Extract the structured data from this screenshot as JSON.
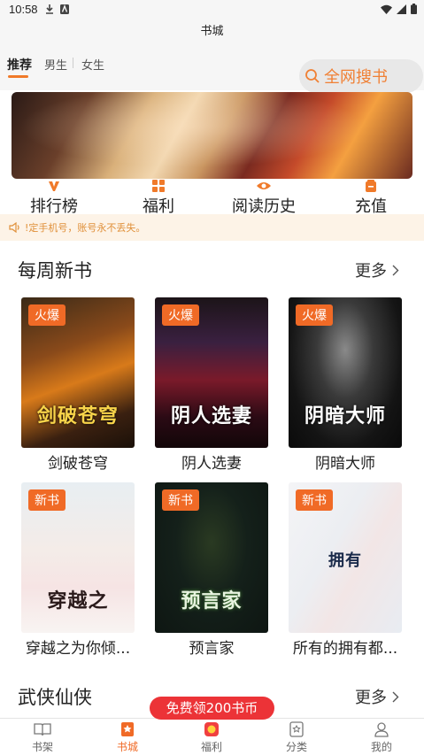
{
  "status_bar": {
    "time": "10:58"
  },
  "header": {
    "title": "书城"
  },
  "tabs": [
    {
      "label": "推荐"
    },
    {
      "label": "男生"
    },
    {
      "label": "女生"
    }
  ],
  "search": {
    "label": "全网搜书"
  },
  "quick_nav": [
    {
      "label": "排行榜",
      "icon": "ranking-icon"
    },
    {
      "label": "福利",
      "icon": "grid-icon"
    },
    {
      "label": "阅读历史",
      "icon": "eye-icon"
    },
    {
      "label": "充值",
      "icon": "wallet-icon"
    }
  ],
  "notice": {
    "text": "!定手机号，账号永不丢失。"
  },
  "section_weekly": {
    "title": "每周新书",
    "more": "更多",
    "books": [
      {
        "name": "剑破苍穹",
        "badge": "火爆",
        "cover_text": "剑破苍穹"
      },
      {
        "name": "阴人选妻",
        "badge": "火爆",
        "cover_text": "阴人选妻"
      },
      {
        "name": "阴暗大师",
        "badge": "火爆",
        "cover_text": "阴暗大师"
      },
      {
        "name": "穿越之为你倾...",
        "badge": "新书",
        "cover_text": "穿越之"
      },
      {
        "name": "预言家",
        "badge": "新书",
        "cover_text": "预言家"
      },
      {
        "name": "所有的拥有都...",
        "badge": "新书",
        "cover_text": "拥有"
      }
    ]
  },
  "section_wuxia": {
    "title": "武侠仙侠",
    "more": "更多"
  },
  "promo": {
    "text": "免费领200书币"
  },
  "bottom_nav": [
    {
      "label": "书架",
      "icon": "bookshelf-icon"
    },
    {
      "label": "书城",
      "icon": "bookstore-icon"
    },
    {
      "label": "福利",
      "icon": "gift-icon"
    },
    {
      "label": "分类",
      "icon": "category-icon"
    },
    {
      "label": "我的",
      "icon": "profile-icon"
    }
  ],
  "colors": {
    "accent": "#f06a26",
    "promo": "#ec3337",
    "notice_bg": "#fdf3e7"
  }
}
